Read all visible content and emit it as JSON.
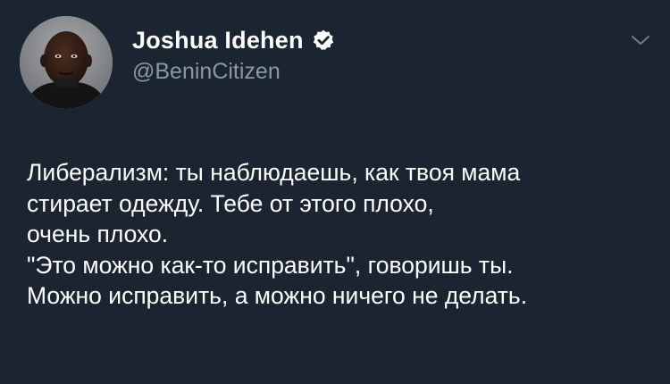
{
  "author": {
    "display_name": "Joshua Idehen",
    "handle": "@BeninCitizen",
    "verified": true
  },
  "tweet": {
    "lines": [
      "Либерализм: ты наблюдаешь, как твоя мама",
      "стирает одежду. Тебе от этого плохо,",
      "очень плохо.",
      "\"Это можно как-то исправить\", говоришь ты.",
      "Можно исправить, а можно ничего не делать."
    ]
  },
  "colors": {
    "background": "#1b2431",
    "name_text": "#ffffff",
    "handle_text": "#8899a6",
    "verified_badge": "#ffffff"
  },
  "icons": {
    "verified": "verified-badge-icon",
    "menu": "chevron-down-icon"
  }
}
